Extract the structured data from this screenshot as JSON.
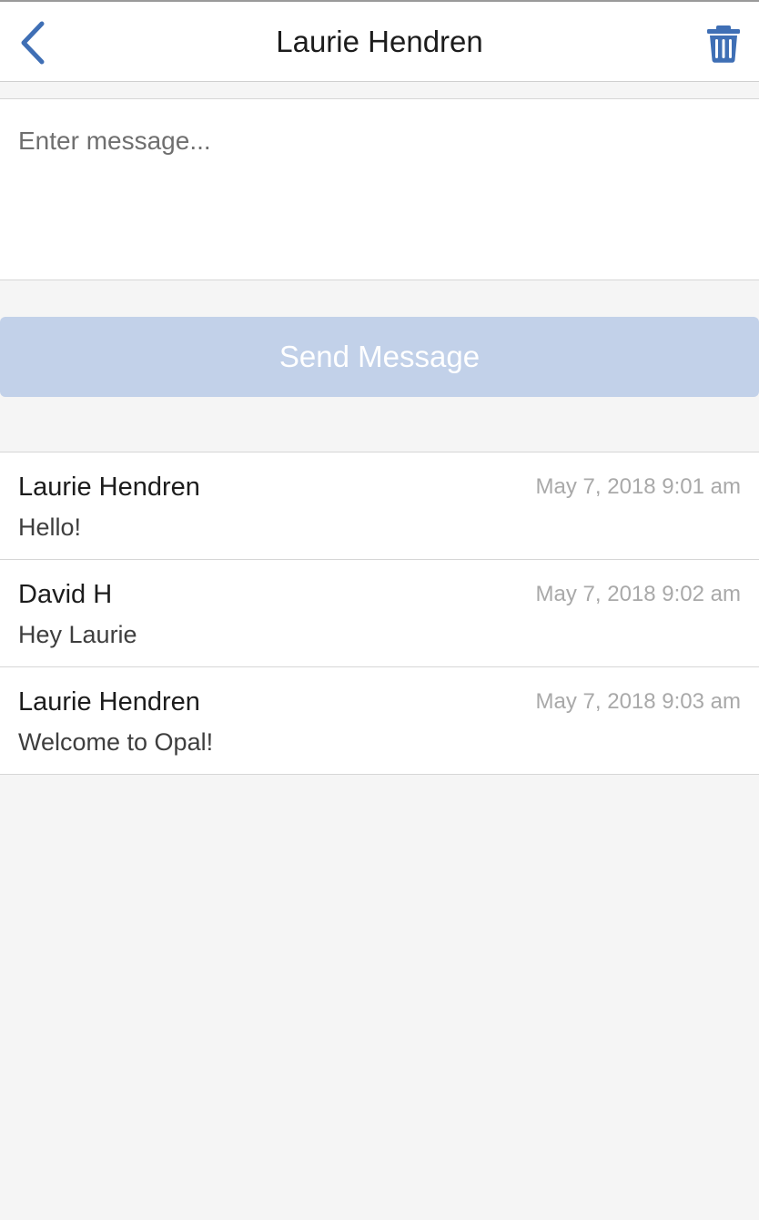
{
  "header": {
    "title": "Laurie Hendren",
    "back_icon": "chevron-left-icon",
    "delete_icon": "trash-icon"
  },
  "compose": {
    "placeholder": "Enter message...",
    "value": ""
  },
  "send_button": {
    "label": "Send Message"
  },
  "colors": {
    "accent": "#3f6fb5",
    "send_disabled": "#c2d1e9",
    "background": "#f5f5f5"
  },
  "messages": [
    {
      "sender": "Laurie Hendren",
      "time": "May 7, 2018 9:01 am",
      "text": "Hello!"
    },
    {
      "sender": "David H",
      "time": "May 7, 2018 9:02 am",
      "text": "Hey Laurie"
    },
    {
      "sender": "Laurie Hendren",
      "time": "May 7, 2018 9:03 am",
      "text": "Welcome to Opal!"
    }
  ]
}
